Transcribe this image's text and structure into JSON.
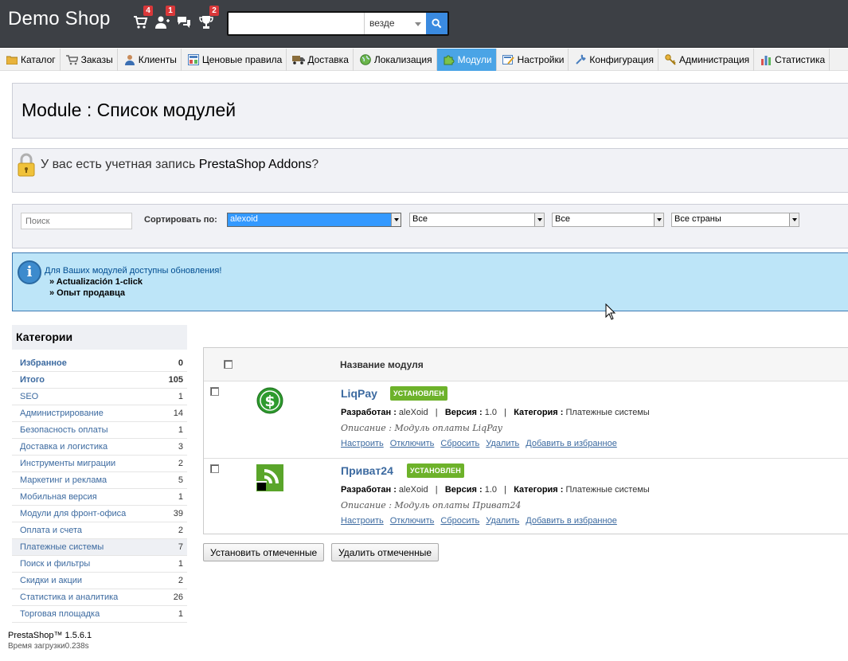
{
  "header": {
    "logo": "Demo Shop",
    "notifications": [
      {
        "icon": "cart-icon",
        "count": "4"
      },
      {
        "icon": "customers-icon",
        "count": "1"
      },
      {
        "icon": "messages-icon",
        "count": ""
      },
      {
        "icon": "trophy-icon",
        "count": "2"
      }
    ],
    "search": {
      "value": "",
      "scope": "везде"
    }
  },
  "nav": [
    {
      "label": "Каталог",
      "icon": "folder-icon"
    },
    {
      "label": "Заказы",
      "icon": "cart-icon"
    },
    {
      "label": "Клиенты",
      "icon": "user-icon"
    },
    {
      "label": "Ценовые правила",
      "icon": "price-rules-icon"
    },
    {
      "label": "Доставка",
      "icon": "truck-icon"
    },
    {
      "label": "Локализация",
      "icon": "globe-icon"
    },
    {
      "label": "Модули",
      "icon": "puzzle-icon"
    },
    {
      "label": "Настройки",
      "icon": "settings-icon"
    },
    {
      "label": "Конфигурация",
      "icon": "wrench-icon"
    },
    {
      "label": "Администрация",
      "icon": "key-icon"
    },
    {
      "label": "Статистика",
      "icon": "chart-icon"
    }
  ],
  "page": {
    "title": "Module : Список модулей"
  },
  "addons_notice": {
    "prefix": "У вас есть учетная запись ",
    "link": "PrestaShop Addons",
    "suffix": "?"
  },
  "filters": {
    "search_placeholder": "Поиск",
    "sort_label": "Сортировать по:",
    "selects": [
      "alexoid",
      "Все",
      "Все",
      "Все страны"
    ]
  },
  "info": {
    "text": "Для Ваших модулей доступны обновления!",
    "items": [
      "» Actualización 1-click",
      "» Опыт продавца"
    ]
  },
  "categories": {
    "title": "Категории",
    "items": [
      {
        "label": "Избранное",
        "count": "0"
      },
      {
        "label": "Итого",
        "count": "105"
      },
      {
        "label": "SEO",
        "count": "1"
      },
      {
        "label": "Администрирование",
        "count": "14"
      },
      {
        "label": "Безопасность оплаты",
        "count": "1"
      },
      {
        "label": "Доставка и логистика",
        "count": "3"
      },
      {
        "label": "Инструменты миграции",
        "count": "2"
      },
      {
        "label": "Маркетинг и реклама",
        "count": "5"
      },
      {
        "label": "Мобильная версия",
        "count": "1"
      },
      {
        "label": "Модули для фронт-офиса",
        "count": "39"
      },
      {
        "label": "Оплата и счета",
        "count": "2"
      },
      {
        "label": "Платежные системы",
        "count": "7"
      },
      {
        "label": "Поиск и фильтры",
        "count": "1"
      },
      {
        "label": "Скидки и акции",
        "count": "2"
      },
      {
        "label": "Статистика и аналитика",
        "count": "26"
      },
      {
        "label": "Торговая площадка",
        "count": "1"
      }
    ]
  },
  "table": {
    "header": "Название модуля",
    "modules": [
      {
        "name": "LiqPay",
        "badge": "УСТАНОВЛЕН",
        "dev_label": "Разработан :",
        "dev": "aleXoid",
        "ver_label": "Версия :",
        "ver": "1.0",
        "cat_label": "Категория :",
        "cat": "Платежные системы",
        "desc": "Описание : Модуль оплаты LiqPay",
        "links": [
          "Настроить",
          "Отключить",
          "Сбросить",
          "Удалить",
          "Добавить в избранное"
        ],
        "logo": "liqpay-logo-icon",
        "logo_color": "#2e9a2e"
      },
      {
        "name": "Приват24",
        "badge": "УСТАНОВЛЕН",
        "dev_label": "Разработан :",
        "dev": "aleXoid",
        "ver_label": "Версия :",
        "ver": "1.0",
        "cat_label": "Категория :",
        "cat": "Платежные системы",
        "desc": "Описание : Модуль оплаты Приват24",
        "links": [
          "Настроить",
          "Отключить",
          "Сбросить",
          "Удалить",
          "Добавить в избранное"
        ],
        "logo": "privat24-logo-icon",
        "logo_color": "#5aa52a"
      }
    ]
  },
  "actions": {
    "install": "Установить отмеченные",
    "delete": "Удалить отмеченные"
  },
  "footer": {
    "version": "PrestaShop™ 1.5.6.1",
    "load_time": "Время загрузки0.238s"
  }
}
